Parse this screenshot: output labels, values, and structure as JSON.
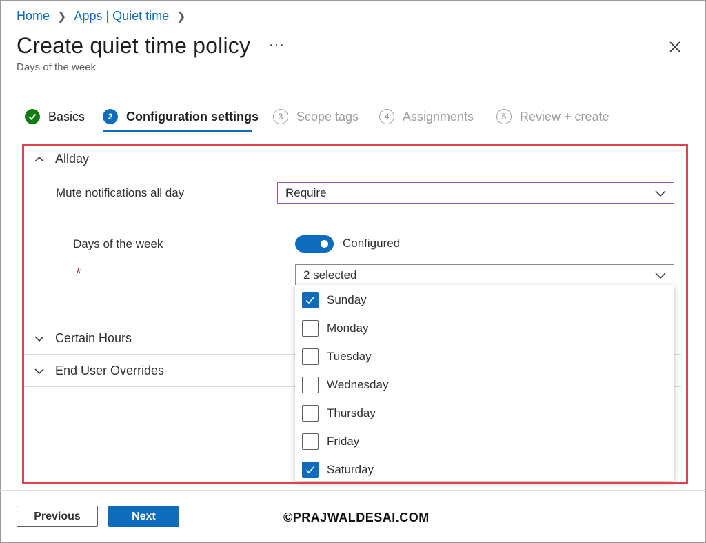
{
  "breadcrumb": {
    "home": "Home",
    "apps": "Apps | Quiet time"
  },
  "header": {
    "title": "Create quiet time policy",
    "more": "···",
    "subtitle": "Days of the week"
  },
  "steps": [
    {
      "number": "1",
      "label": "Basics",
      "state": "done"
    },
    {
      "number": "2",
      "label": "Configuration settings",
      "state": "active"
    },
    {
      "number": "3",
      "label": "Scope tags",
      "state": "pending"
    },
    {
      "number": "4",
      "label": "Assignments",
      "state": "pending"
    },
    {
      "number": "5",
      "label": "Review + create",
      "state": "pending"
    }
  ],
  "sections": {
    "allday": {
      "label": "Allday",
      "mute_label": "Mute notifications all day",
      "mute_value": "Require",
      "days_label": "Days of the week",
      "toggle_label": "Configured",
      "toggle_on": true,
      "required_mark": "*",
      "days_value": "2 selected"
    },
    "certain_hours": {
      "label": "Certain Hours"
    },
    "end_user_overrides": {
      "label": "End User Overrides"
    }
  },
  "days_options": [
    {
      "label": "Sunday",
      "checked": true
    },
    {
      "label": "Monday",
      "checked": false
    },
    {
      "label": "Tuesday",
      "checked": false
    },
    {
      "label": "Wednesday",
      "checked": false
    },
    {
      "label": "Thursday",
      "checked": false
    },
    {
      "label": "Friday",
      "checked": false
    },
    {
      "label": "Saturday",
      "checked": true
    }
  ],
  "footer": {
    "previous": "Previous",
    "next": "Next"
  },
  "watermark": "©PRAJWALDESAI.COM",
  "colors": {
    "accent": "#0f6cbd",
    "success": "#107c10",
    "highlight": "#e0434e"
  }
}
